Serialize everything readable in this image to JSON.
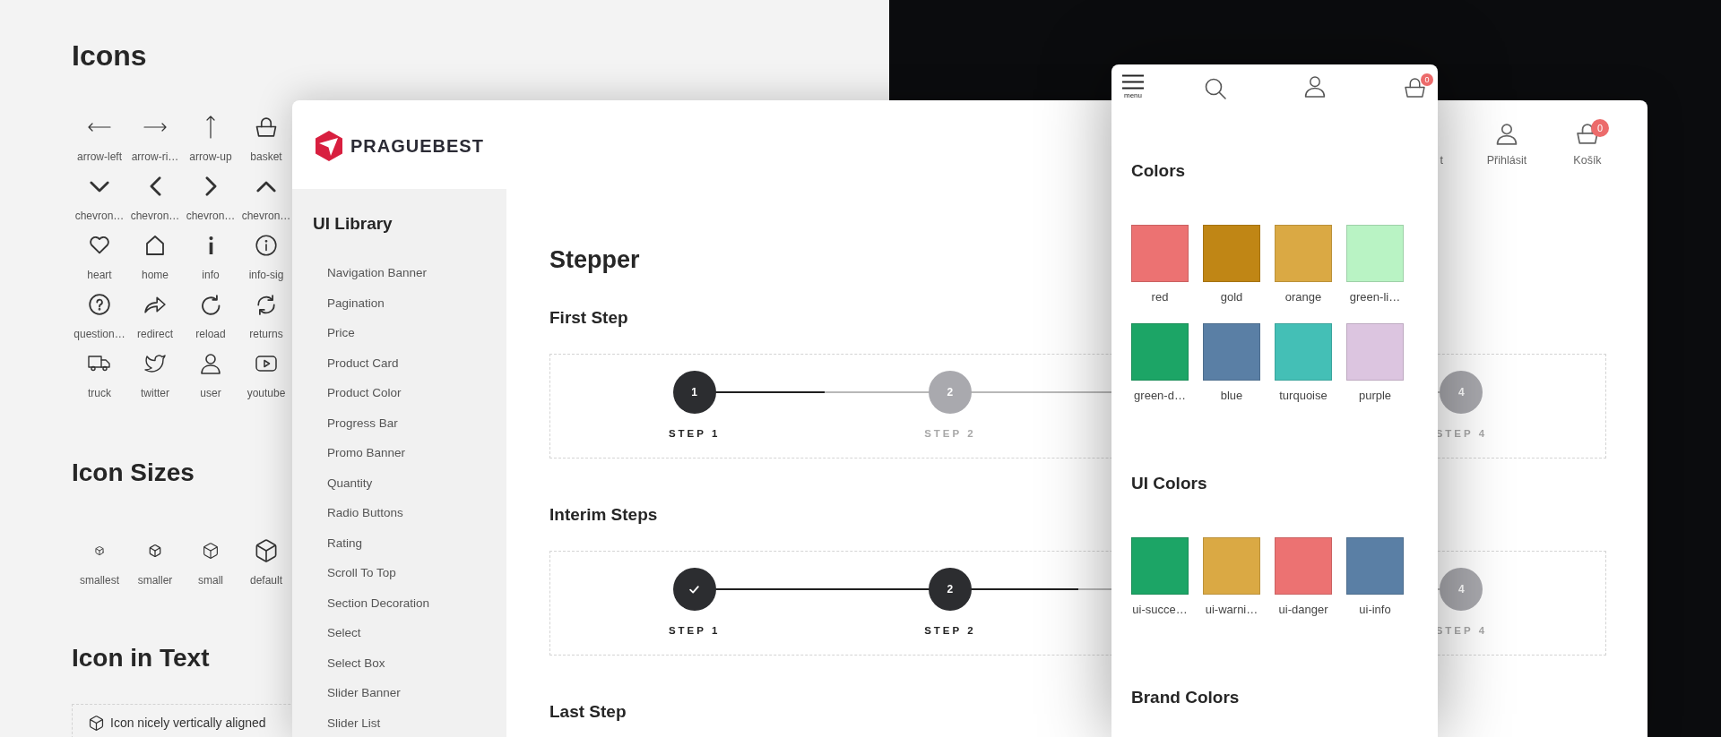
{
  "icons_page": {
    "title": "Icons",
    "icons": [
      {
        "label": "arrow-left"
      },
      {
        "label": "arrow-ri…"
      },
      {
        "label": "arrow-up"
      },
      {
        "label": "basket"
      },
      {
        "label": "chevron…"
      },
      {
        "label": "chevron…"
      },
      {
        "label": "chevron…"
      },
      {
        "label": "chevron…"
      },
      {
        "label": "heart"
      },
      {
        "label": "home"
      },
      {
        "label": "info"
      },
      {
        "label": "info-sig"
      },
      {
        "label": "question…"
      },
      {
        "label": "redirect"
      },
      {
        "label": "reload"
      },
      {
        "label": "returns"
      },
      {
        "label": "truck"
      },
      {
        "label": "twitter"
      },
      {
        "label": "user"
      },
      {
        "label": "youtube"
      }
    ],
    "sizes_title": "Icon Sizes",
    "sizes": [
      {
        "label": "smallest"
      },
      {
        "label": "smaller"
      },
      {
        "label": "small"
      },
      {
        "label": "default"
      }
    ],
    "text_title": "Icon in Text",
    "text_example": "Icon nicely vertically aligned"
  },
  "desktop_window": {
    "logo_text": "PRAGUEBEST",
    "nav": [
      {
        "kind": "label",
        "label": "t"
      },
      {
        "kind": "account",
        "label": "Přihlásit"
      },
      {
        "kind": "cart",
        "label": "Košík",
        "badge": "0"
      }
    ],
    "sidebar": {
      "title": "UI Library",
      "items": [
        "Navigation Banner",
        "Pagination",
        "Price",
        "Product Card",
        "Product Color",
        "Progress Bar",
        "Promo Banner",
        "Quantity",
        "Radio Buttons",
        "Rating",
        "Scroll To Top",
        "Section Decoration",
        "Select",
        "Select Box",
        "Slider Banner",
        "Slider List"
      ]
    },
    "page_title": "Stepper",
    "sections": [
      {
        "title": "First Step",
        "level": 0.17,
        "steps": [
          {
            "number": "1",
            "label": "STEP 1",
            "reached": true,
            "done": false
          },
          {
            "number": "2",
            "label": "STEP 2",
            "reached": false,
            "done": false
          },
          {
            "number": "4",
            "label": "STEP 4",
            "reached": false,
            "done": false
          }
        ]
      },
      {
        "title": "Interim Steps",
        "level": 0.5,
        "steps": [
          {
            "label": "STEP 1",
            "reached": true,
            "done": true
          },
          {
            "number": "2",
            "label": "STEP 2",
            "reached": true,
            "done": false
          },
          {
            "number": "4",
            "label": "STEP 4",
            "reached": false,
            "done": false
          }
        ]
      },
      {
        "title": "Last Step"
      }
    ]
  },
  "mobile_window": {
    "menu_label": "menu",
    "cart_badge": "0",
    "groups": [
      {
        "title": "Colors",
        "swatches": [
          {
            "label": "red",
            "color": "#ec7272"
          },
          {
            "label": "gold",
            "color": "#c08615"
          },
          {
            "label": "orange",
            "color": "#daa944"
          },
          {
            "label": "green-li…",
            "color": "#b9f3c4"
          },
          {
            "label": "green-d…",
            "color": "#1ca566"
          },
          {
            "label": "blue",
            "color": "#5a7fa5"
          },
          {
            "label": "turquoise",
            "color": "#44bfb6"
          },
          {
            "label": "purple",
            "color": "#dcc5e0"
          }
        ]
      },
      {
        "title": "UI Colors",
        "swatches": [
          {
            "label": "ui-succe…",
            "color": "#1ca566"
          },
          {
            "label": "ui-warni…",
            "color": "#daa944"
          },
          {
            "label": "ui-danger",
            "color": "#ec7272"
          },
          {
            "label": "ui-info",
            "color": "#5a7fa5"
          }
        ]
      },
      {
        "title": "Brand Colors"
      }
    ]
  }
}
